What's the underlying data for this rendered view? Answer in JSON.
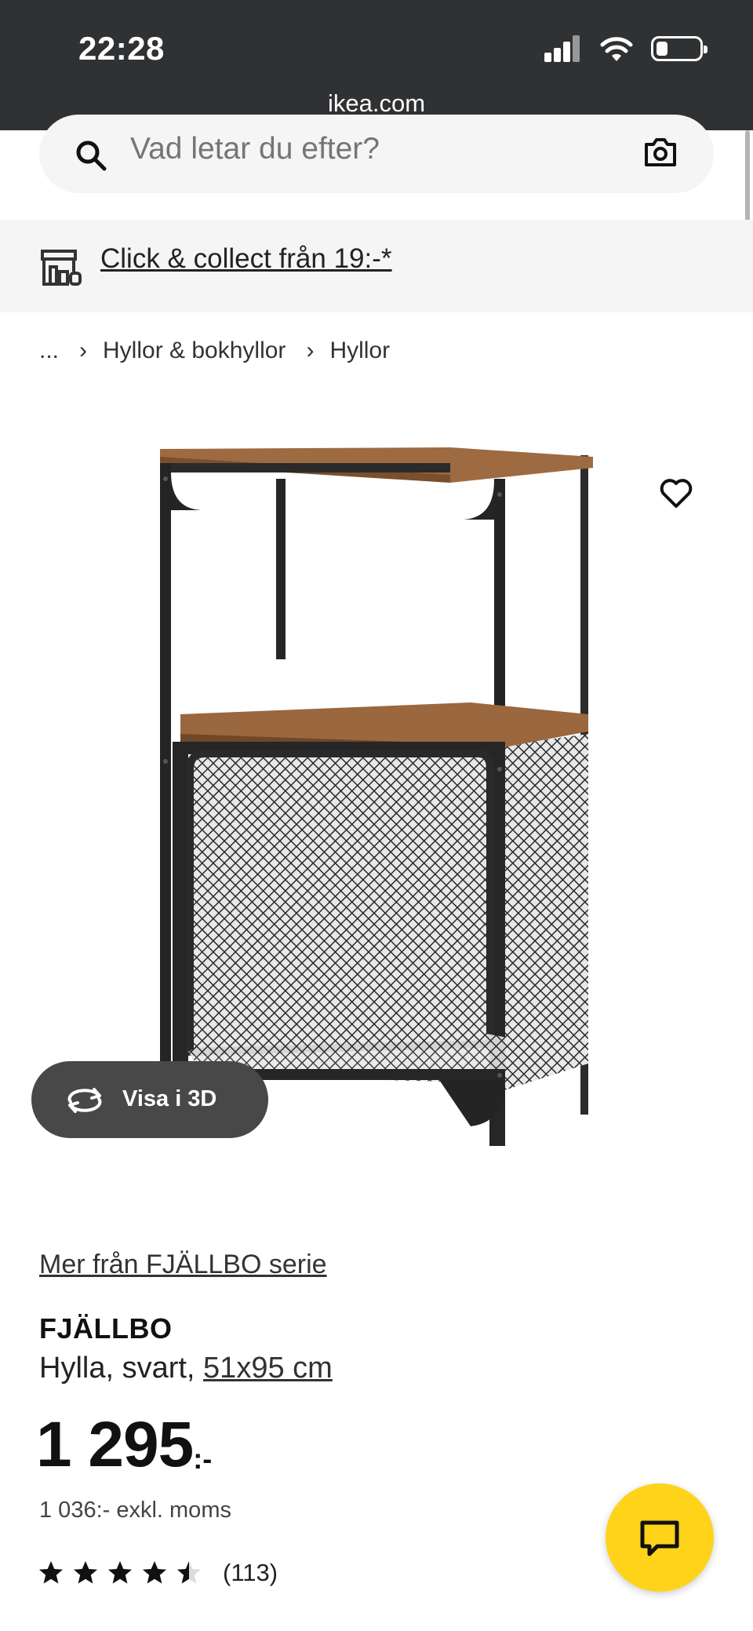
{
  "status_bar": {
    "time": "22:28",
    "url": "ikea.com"
  },
  "search": {
    "placeholder": "Vad letar du efter?"
  },
  "collect": {
    "label": "Click & collect från 19:-*"
  },
  "breadcrumb": {
    "items": [
      "...",
      "Hyllor & bokhyllor",
      "Hyllor"
    ],
    "separator": "›"
  },
  "product": {
    "visa_3d_label": "Visa i 3D",
    "series_link": "Mer från FJÄLLBO serie",
    "name": "FJÄLLBO",
    "description": "Hylla, svart,",
    "size": "51x95 cm",
    "price": "1 295",
    "price_suffix": ":-",
    "price_ex_vat": "1 036:- exkl. moms",
    "rating_value": 4.5,
    "rating_max": 5,
    "rating_count": "(113)"
  },
  "colors": {
    "status_bar_bg": "#2f3133",
    "chat_button": "#ffd31a",
    "visa_3d_bg": "#484848",
    "search_bg": "#f5f5f5"
  },
  "icons": {
    "search": "search-icon",
    "camera": "camera-icon",
    "store": "store-icon",
    "heart": "heart-icon",
    "rotate": "rotate-3d-icon",
    "chat": "chat-icon",
    "star": "star-icon"
  }
}
